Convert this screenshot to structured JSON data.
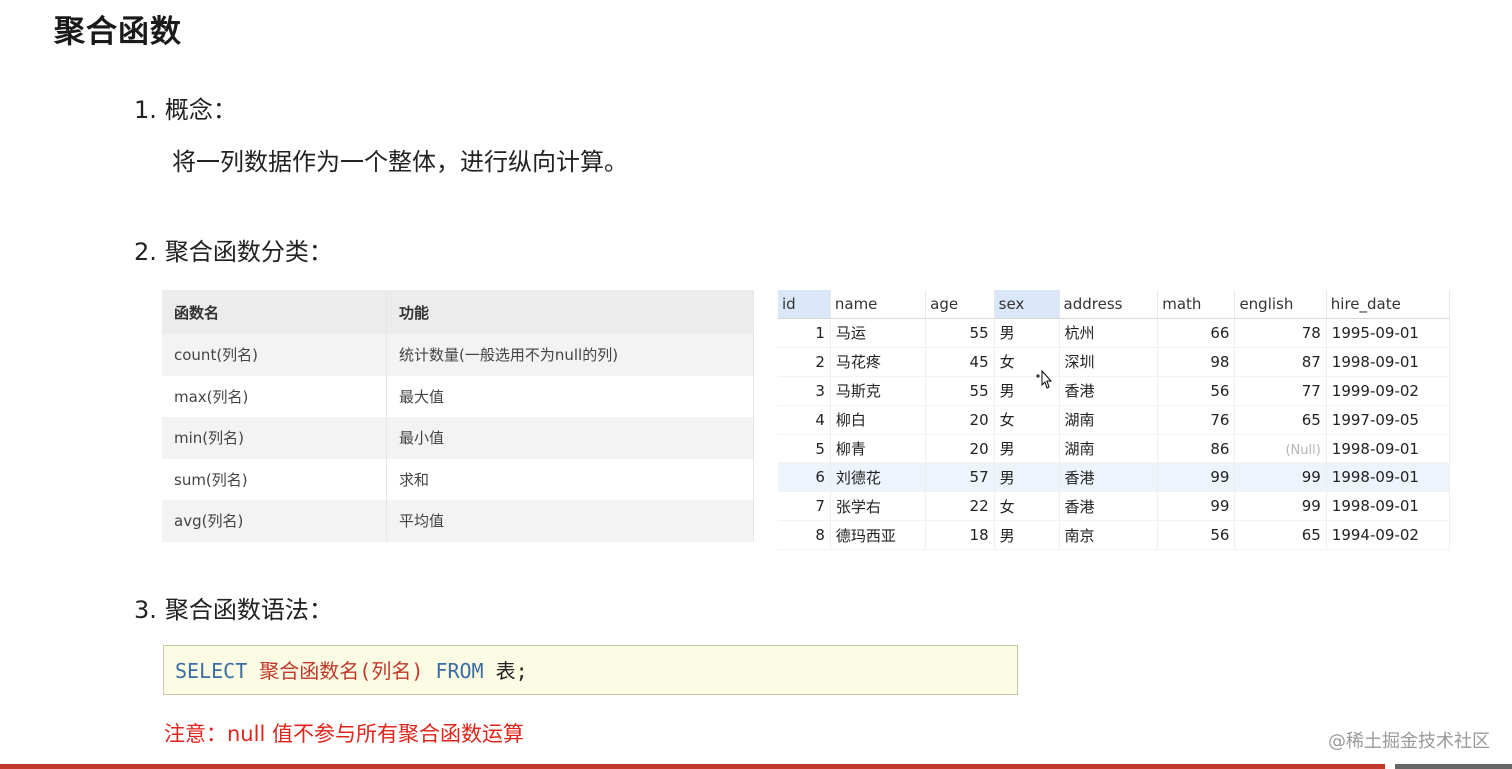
{
  "title": "聚合函数",
  "sections": {
    "concept": {
      "num": "1.",
      "label": "概念：",
      "text": "将一列数据作为一个整体，进行纵向计算。"
    },
    "category": {
      "num": "2.",
      "label": "聚合函数分类："
    },
    "syntax": {
      "num": "3.",
      "label": "聚合函数语法："
    }
  },
  "function_table": {
    "headers": [
      "函数名",
      "功能"
    ],
    "rows": [
      [
        "count(列名)",
        "统计数量(一般选用不为null的列)"
      ],
      [
        "max(列名)",
        "最大值"
      ],
      [
        "min(列名)",
        "最小值"
      ],
      [
        "sum(列名)",
        "求和"
      ],
      [
        "avg(列名)",
        "平均值"
      ]
    ]
  },
  "data_grid": {
    "headers": [
      "id",
      "name",
      "age",
      "sex",
      "address",
      "math",
      "english",
      "hire_date"
    ],
    "highlighted_headers": [
      "id",
      "sex"
    ],
    "rows": [
      [
        "1",
        "马运",
        "55",
        "男",
        "杭州",
        "66",
        "78",
        "1995-09-01"
      ],
      [
        "2",
        "马花疼",
        "45",
        "女",
        "深圳",
        "98",
        "87",
        "1998-09-01"
      ],
      [
        "3",
        "马斯克",
        "55",
        "男",
        "香港",
        "56",
        "77",
        "1999-09-02"
      ],
      [
        "4",
        "柳白",
        "20",
        "女",
        "湖南",
        "76",
        "65",
        "1997-09-05"
      ],
      [
        "5",
        "柳青",
        "20",
        "男",
        "湖南",
        "86",
        "(Null)",
        "1998-09-01"
      ],
      [
        "6",
        "刘德花",
        "57",
        "男",
        "香港",
        "99",
        "99",
        "1998-09-01"
      ],
      [
        "7",
        "张学右",
        "22",
        "女",
        "香港",
        "99",
        "99",
        "1998-09-01"
      ],
      [
        "8",
        "德玛西亚",
        "18",
        "男",
        "南京",
        "56",
        "65",
        "1994-09-02"
      ]
    ],
    "selected_row": 6
  },
  "code": {
    "kw1": "SELECT",
    "fn": "聚合函数名(列名)",
    "kw2": "FROM",
    "table": "表;"
  },
  "note": "注意：null 值不参与所有聚合函数运算",
  "watermark": "@稀土掘金技术社区",
  "colors": {
    "accent_red": "#e0241b",
    "keyword_blue": "#3a6ea5",
    "code_bg": "#fcfbe3",
    "header_highlight": "#d9e7f8"
  }
}
